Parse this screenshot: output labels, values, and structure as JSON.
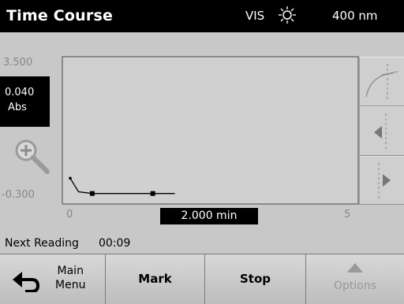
{
  "header": {
    "title": "Time Course",
    "mode": "VIS",
    "lamp_icon": "lamp-sun-icon",
    "wavelength": "400 nm"
  },
  "graph": {
    "y_max_label": "3.500",
    "y_min_label": "-0.300",
    "x_min_label": "0",
    "x_max_label": "5",
    "reading_value": "0.040",
    "reading_unit": "Abs",
    "cursor_time": "2.000 min"
  },
  "chart_data": {
    "type": "line",
    "x": [
      0.0,
      0.15,
      0.4,
      1.5,
      1.9
    ],
    "y": [
      0.25,
      -0.15,
      -0.2,
      -0.2,
      -0.2
    ],
    "markers": [
      {
        "x": 0.4,
        "y": -0.2
      },
      {
        "x": 1.5,
        "y": -0.2
      }
    ],
    "xlim": [
      0,
      5
    ],
    "ylim": [
      -0.3,
      3.5
    ],
    "xlabel": "",
    "ylabel": ""
  },
  "status": {
    "next_reading_label": "Next Reading",
    "next_reading_value": "00:09"
  },
  "side_buttons": [
    "curve-view-icon",
    "cursor-left-icon",
    "cursor-right-icon"
  ],
  "bottom_bar": {
    "main_menu_line1": "Main",
    "main_menu_line2": "Menu",
    "mark": "Mark",
    "stop": "Stop",
    "options": "Options"
  },
  "colors": {
    "title_bar": "#000000",
    "screen": "#c8c8c8",
    "disabled_text": "#999999"
  }
}
